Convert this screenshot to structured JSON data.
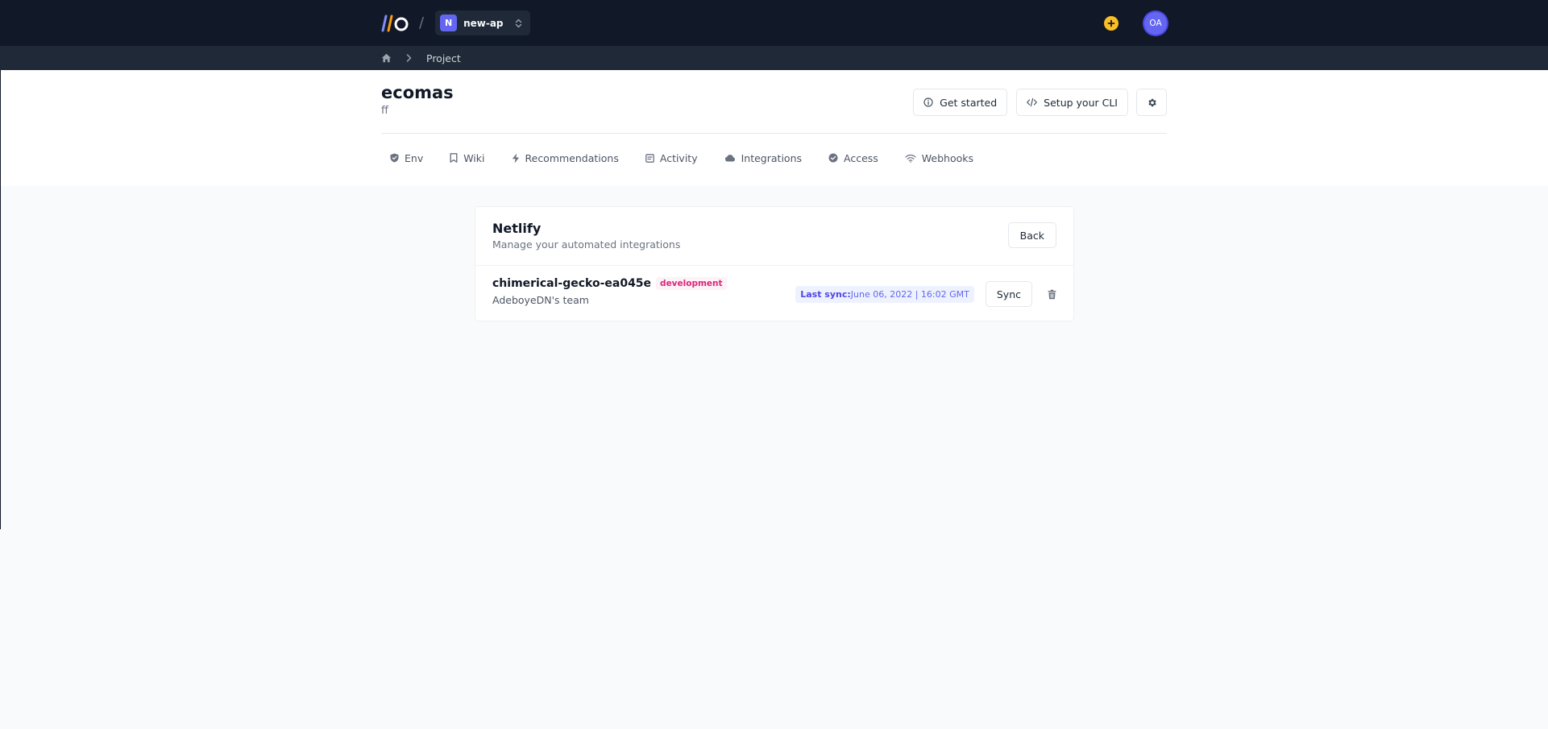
{
  "topbar": {
    "project": {
      "initial": "N",
      "name": "new-ap"
    },
    "user_initials": "OA"
  },
  "breadcrumb": {
    "current": "Project"
  },
  "header": {
    "title": "ecomas",
    "subtitle": "ff",
    "get_started": "Get started",
    "setup_cli": "Setup your CLI"
  },
  "tabs": [
    {
      "label": "Env",
      "icon": "shield-icon"
    },
    {
      "label": "Wiki",
      "icon": "bookmark-icon"
    },
    {
      "label": "Recommendations",
      "icon": "lightning-icon"
    },
    {
      "label": "Activity",
      "icon": "feed-icon"
    },
    {
      "label": "Integrations",
      "icon": "cloud-icon"
    },
    {
      "label": "Access",
      "icon": "check-badge-icon"
    },
    {
      "label": "Webhooks",
      "icon": "wifi-icon"
    }
  ],
  "card": {
    "title": "Netlify",
    "subtitle": "Manage your automated integrations",
    "back": "Back",
    "item": {
      "name": "chimerical-gecko-ea045e",
      "environment": "development",
      "team": "AdeboyeDN's team",
      "sync_label": "Last sync:",
      "sync_value": "June 06, 2022 | 16:02 GMT",
      "sync_button": "Sync"
    }
  },
  "colors": {
    "topbar": "#111827",
    "accent": "#6366f1",
    "badge_text": "#db2777",
    "plus": "#fbbf24"
  }
}
